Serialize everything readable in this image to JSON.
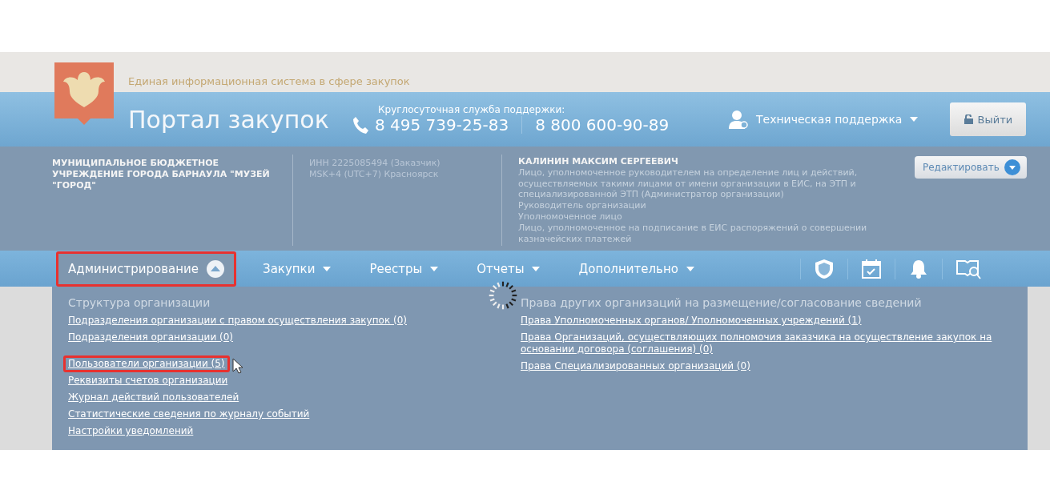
{
  "header": {
    "tagline": "Единая информационная система в сфере закупок",
    "title": "Портал закупок",
    "support_label": "Круглосуточная служба поддержки:",
    "phones": [
      "8 495 739-25-83",
      "8 800 600-90-89"
    ],
    "support_menu": "Техническая поддержка",
    "logout": "Выйти"
  },
  "org": {
    "name": "МУНИЦИПАЛЬНОЕ БЮДЖЕТНОЕ УЧРЕЖДЕНИЕ ГОРОДА БАРНАУЛА \"МУЗЕЙ \"ГОРОД\"",
    "details": [
      "ИНН 2225085494 (Заказчик)",
      "MSK+4 (UTC+7) Красноярск"
    ]
  },
  "user": {
    "name": "КАЛИНИН МАКСИМ СЕРГЕЕВИЧ",
    "roles": [
      "Лицо, уполномоченное руководителем на определение лиц и действий, осуществляемых такими лицами от имени организации в ЕИС, на ЭТП и специализированной ЭТП (Администратор организации)",
      "Руководитель организации",
      "Уполномоченное лицо",
      "Лицо, уполномоченное на подписание в ЕИС распоряжений о совершении казначейских платежей"
    ],
    "edit": "Редактировать"
  },
  "nav": [
    {
      "label": "Администрирование",
      "expanded": true,
      "highlighted": true
    },
    {
      "label": "Закупки",
      "expanded": false,
      "highlighted": false
    },
    {
      "label": "Реестры",
      "expanded": false,
      "highlighted": false
    },
    {
      "label": "Отчеты",
      "expanded": false,
      "highlighted": false
    },
    {
      "label": "Дополнительно",
      "expanded": false,
      "highlighted": false
    }
  ],
  "dropdown": {
    "columns": [
      {
        "heading": "Структура организации",
        "link_groups": [
          [
            {
              "label": "Подразделения организации с правом осуществления закупок (0)",
              "highlighted": false
            },
            {
              "label": "Подразделения организации (0)",
              "highlighted": false
            }
          ],
          [
            {
              "label": "Пользователи организации (5)",
              "highlighted": true
            },
            {
              "label": "Реквизиты счетов организации",
              "highlighted": false
            },
            {
              "label": "Журнал действий пользователей",
              "highlighted": false
            },
            {
              "label": "Статистические сведения по журналу событий",
              "highlighted": false
            },
            {
              "label": "Настройки уведомлений",
              "highlighted": false
            }
          ]
        ]
      },
      {
        "heading": "Права других организаций на размещение/согласование сведений",
        "link_groups": [
          [
            {
              "label": "Права Уполномоченных органов/ Уполномоченных учреждений (1)",
              "highlighted": false
            },
            {
              "label": "Права Организаций, осуществляющих полномочия заказчика на осуществление закупок на основании договора (соглашения) (0)",
              "highlighted": false
            },
            {
              "label": "Права Специализированных организаций (0)",
              "highlighted": false
            }
          ]
        ]
      }
    ]
  }
}
